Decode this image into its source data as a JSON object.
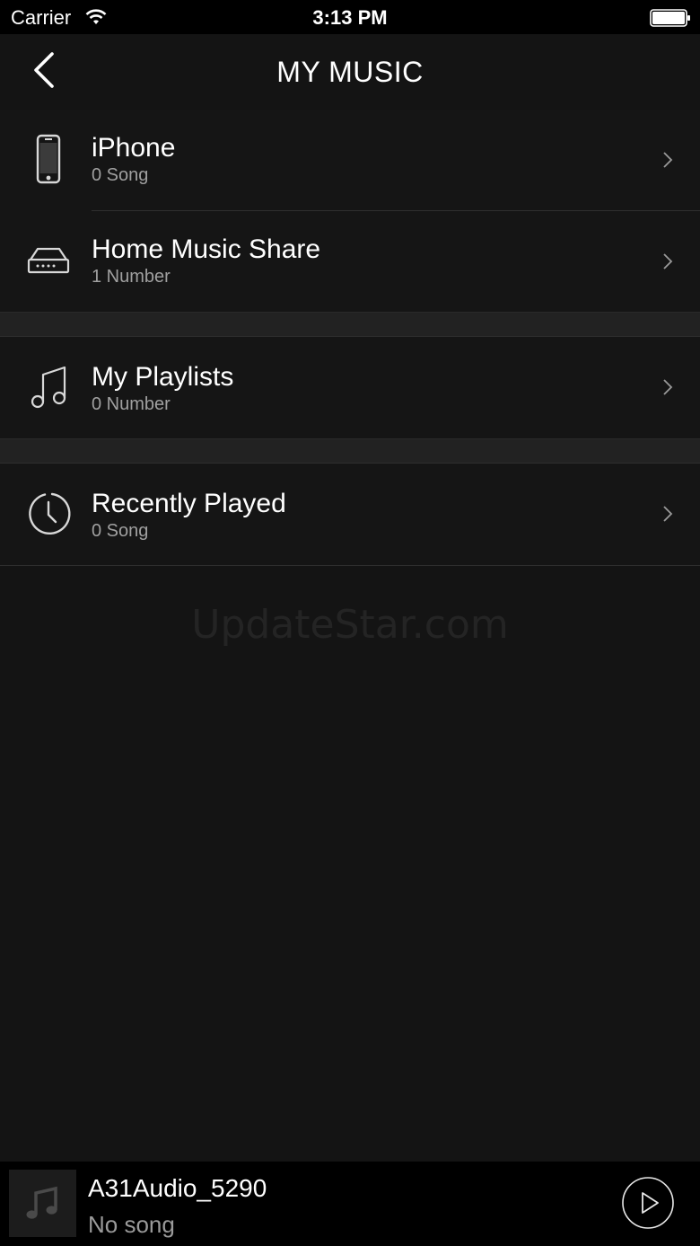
{
  "status": {
    "carrier": "Carrier",
    "time": "3:13 PM"
  },
  "header": {
    "title": "MY MUSIC"
  },
  "rows": [
    {
      "title": "iPhone",
      "subtitle": "0 Song",
      "icon": "phone-icon"
    },
    {
      "title": "Home Music Share",
      "subtitle": "1 Number",
      "icon": "media-server-icon"
    },
    {
      "title": "My Playlists",
      "subtitle": "0 Number",
      "icon": "music-note-icon"
    },
    {
      "title": "Recently Played",
      "subtitle": "0 Song",
      "icon": "clock-icon"
    }
  ],
  "watermark": "UpdateStar.com",
  "player": {
    "device": "A31Audio_5290",
    "song": "No song"
  },
  "colors": {
    "background": "#141414",
    "bar": "#000000",
    "subtitle": "#a0a0a0"
  }
}
